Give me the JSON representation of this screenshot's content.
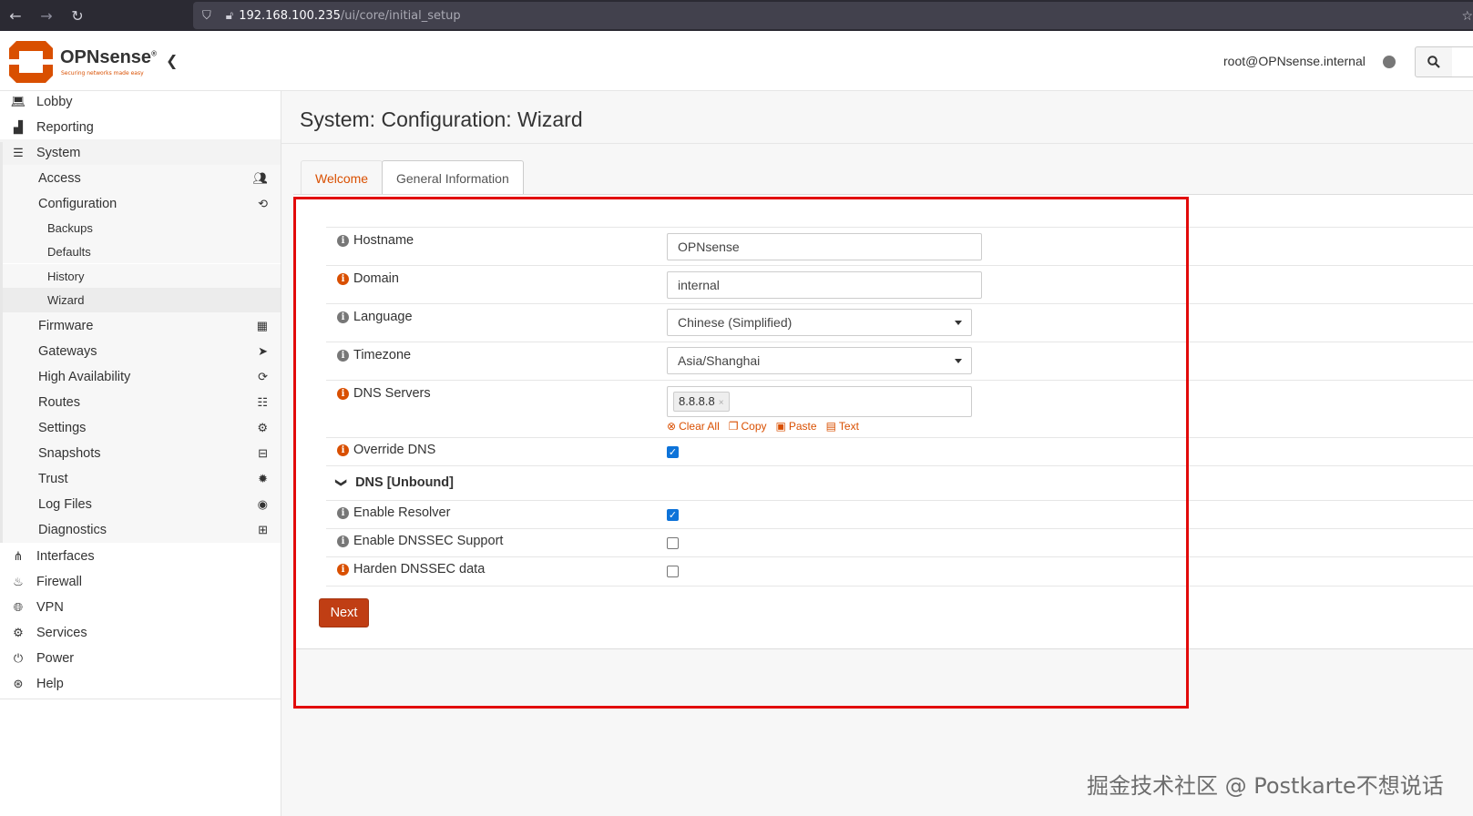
{
  "browser": {
    "url_host": "192.168.100.235",
    "url_path": "/ui/core/initial_setup"
  },
  "header": {
    "brand": "OPNsense",
    "brand_mark": "®",
    "tagline": "Securing networks made easy",
    "user": "root@OPNsense.internal"
  },
  "sidebar": {
    "items": [
      {
        "label": "Lobby",
        "icon": "laptop-icon"
      },
      {
        "label": "Reporting",
        "icon": "area-chart-icon"
      },
      {
        "label": "System",
        "icon": "server-icon"
      },
      {
        "label": "Access",
        "icon": "users-icon"
      },
      {
        "label": "Configuration",
        "icon": "history-icon"
      },
      {
        "label": "Backups"
      },
      {
        "label": "Defaults"
      },
      {
        "label": "History"
      },
      {
        "label": "Wizard"
      },
      {
        "label": "Firmware",
        "icon": "building-icon"
      },
      {
        "label": "Gateways",
        "icon": "location-arrow-icon"
      },
      {
        "label": "High Availability",
        "icon": "refresh-icon"
      },
      {
        "label": "Routes",
        "icon": "map-signs-icon"
      },
      {
        "label": "Settings",
        "icon": "cogs-icon"
      },
      {
        "label": "Snapshots",
        "icon": "hdd-icon"
      },
      {
        "label": "Trust",
        "icon": "certificate-icon"
      },
      {
        "label": "Log Files",
        "icon": "eye-icon"
      },
      {
        "label": "Diagnostics",
        "icon": "medkit-icon"
      },
      {
        "label": "Interfaces",
        "icon": "sitemap-icon"
      },
      {
        "label": "Firewall",
        "icon": "fire-icon"
      },
      {
        "label": "VPN",
        "icon": "globe-icon"
      },
      {
        "label": "Services",
        "icon": "cog-icon"
      },
      {
        "label": "Power",
        "icon": "plug-icon"
      },
      {
        "label": "Help",
        "icon": "life-ring-icon"
      }
    ]
  },
  "main": {
    "title": "System: Configuration: Wizard",
    "tabs": [
      {
        "label": "Welcome"
      },
      {
        "label": "General Information"
      }
    ],
    "form": {
      "hostname": {
        "label": "Hostname",
        "value": "OPNsense"
      },
      "domain": {
        "label": "Domain",
        "value": "internal"
      },
      "language": {
        "label": "Language",
        "value": "Chinese (Simplified)"
      },
      "timezone": {
        "label": "Timezone",
        "value": "Asia/Shanghai"
      },
      "dns_servers": {
        "label": "DNS Servers",
        "tag": "8.8.8.8",
        "tag_remove": "×"
      },
      "dns_tools": {
        "clear_all": "Clear All",
        "copy": "Copy",
        "paste": "Paste",
        "text": "Text"
      },
      "override_dns": {
        "label": "Override DNS",
        "checked": true
      },
      "section_unbound": "DNS [Unbound]",
      "enable_resolver": {
        "label": "Enable Resolver",
        "checked": true
      },
      "enable_dnssec": {
        "label": "Enable DNSSEC Support",
        "checked": false
      },
      "harden_dnssec": {
        "label": "Harden DNSSEC data",
        "checked": false
      }
    },
    "next_button": "Next"
  },
  "watermark": "掘金技术社区 @ Postkarte不想说话",
  "colors": {
    "accent": "#d94f00",
    "button": "#c03e14",
    "checkbox": "#0d73d9",
    "highlight_box": "#e20a0a"
  }
}
